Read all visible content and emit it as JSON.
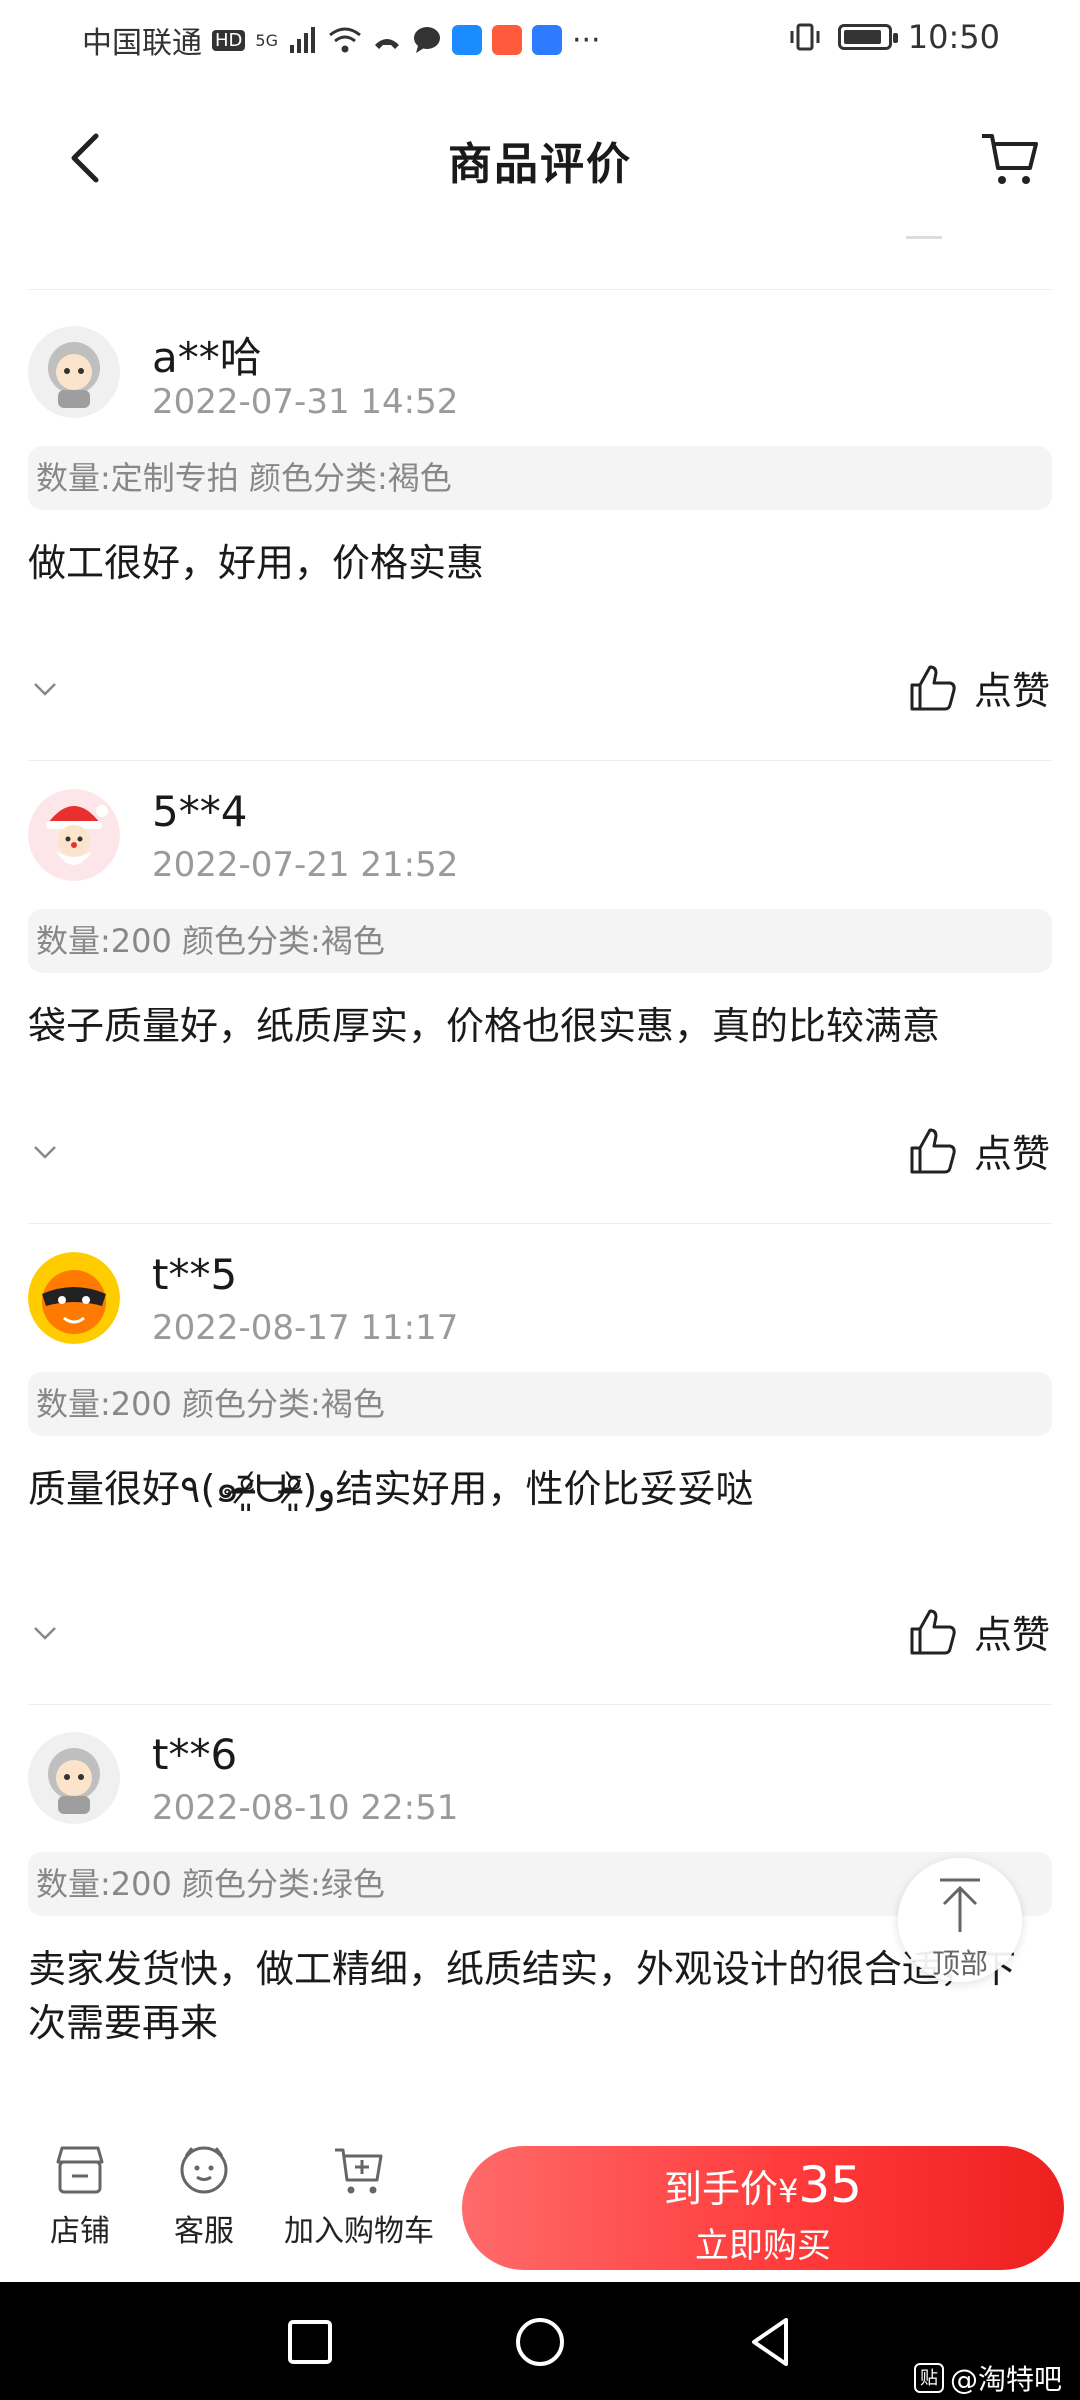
{
  "status_bar": {
    "carrier": "中国联通",
    "network_badge": "HD",
    "signal_label": "5G",
    "more": "···",
    "time": "10:50",
    "battery_level": 0.85
  },
  "nav": {
    "title": "商品评价",
    "back_icon": "back-chevron-icon",
    "cart_icon": "cart-icon"
  },
  "reviews": [
    {
      "username": "a**哈",
      "date": "2022-07-31 14:52",
      "spec": "数量:定制专拍 颜色分类:褐色",
      "text": "做工很好，好用，价格实惠",
      "like_label": "点赞",
      "avatar": "gray-robot-avatar"
    },
    {
      "username": "5**4",
      "date": "2022-07-21 21:52",
      "spec": "数量:200 颜色分类:褐色",
      "text": "袋子质量好，纸质厚实，价格也很实惠，真的比较满意",
      "like_label": "点赞",
      "avatar": "santa-avatar"
    },
    {
      "username": "t**5",
      "date": "2022-08-17 11:17",
      "spec": "数量:200 颜色分类:褐色",
      "text": "质量很好٩(๑ᵒ̴̶̷͈᷄ᗨᵒ̴̶̷͈᷅)و结实好用，性价比妥妥哒",
      "like_label": "点赞",
      "avatar": "orange-mascot-avatar"
    },
    {
      "username": "t**6",
      "date": "2022-08-10 22:51",
      "spec": "数量:200 颜色分类:绿色",
      "text": "卖家发货快，做工精细，纸质结实，外观设计的很合适，下次需要再来",
      "avatar": "gray-robot-avatar"
    }
  ],
  "float_top": {
    "label": "顶部"
  },
  "action_bar": {
    "shop_label": "店铺",
    "service_label": "客服",
    "add_cart_label": "加入购物车",
    "buy_price_prefix": "到手价",
    "buy_price_currency": "¥",
    "buy_price_value": "35",
    "buy_label": "立即购买",
    "buy_color": "#ff3a3a"
  },
  "watermark": {
    "box": "贴",
    "text": "@淘特吧"
  }
}
